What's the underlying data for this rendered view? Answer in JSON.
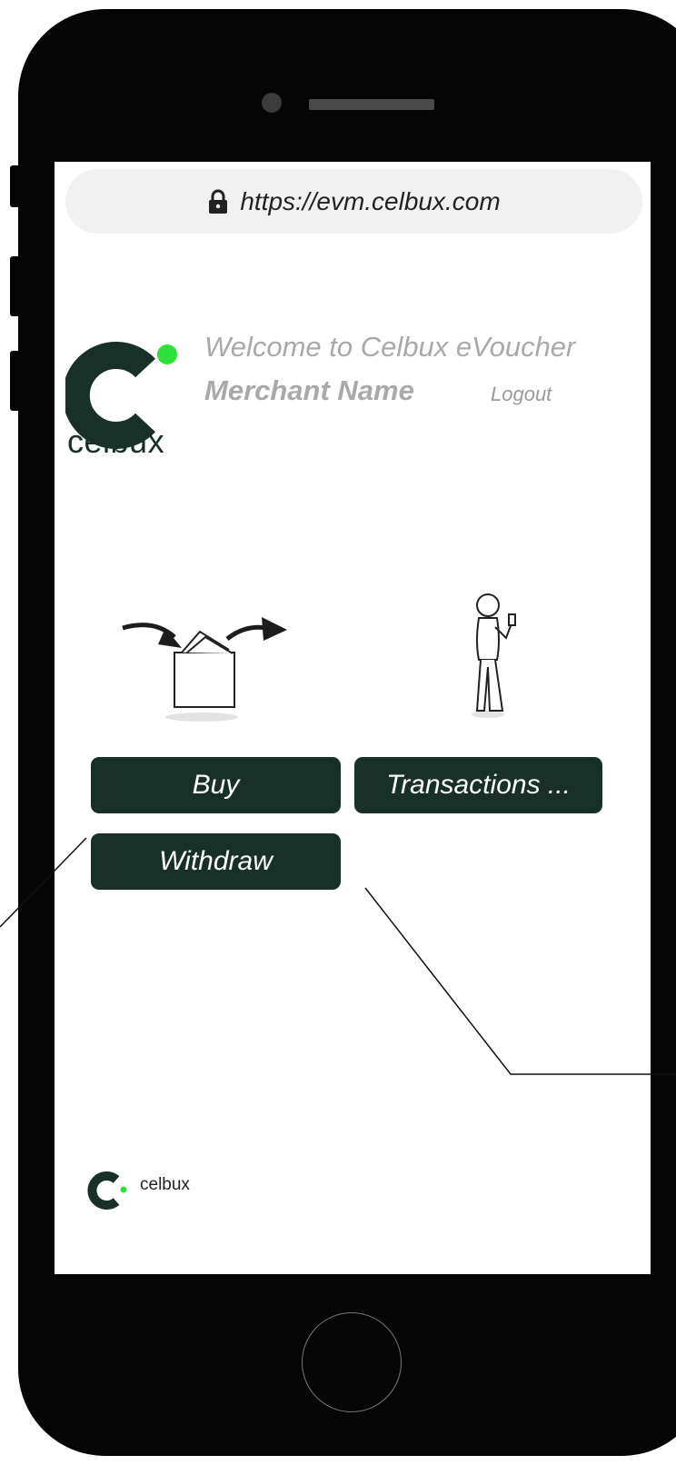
{
  "browser": {
    "url": "https://evm.celbux.com"
  },
  "header": {
    "logo_text": "celbux",
    "welcome": "Welcome to Celbux eVoucher",
    "merchant_name": "Merchant Name",
    "logout_label": "Logout"
  },
  "actions": {
    "buy_label": "Buy",
    "transactions_label": "Transactions ...",
    "withdraw_label": "Withdraw"
  },
  "footer": {
    "logo_text": "celbux"
  },
  "colors": {
    "brand_dark": "#193028",
    "brand_green": "#2ee03a",
    "frame": "#050505"
  },
  "icons": {
    "lock": "lock-icon",
    "wallet": "wallet-illustration",
    "person": "person-phone-illustration"
  }
}
